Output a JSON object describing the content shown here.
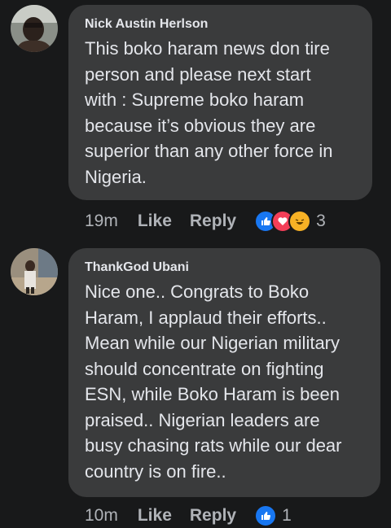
{
  "comments": [
    {
      "author": "Nick Austin Herlson",
      "text": "This boko haram news don tire\nperson and please next start\nwith : Supreme boko haram\nbecause it’s obvious they are\nsuperior than any other force in\nNigeria.",
      "time": "19m",
      "like_label": "Like",
      "reply_label": "Reply",
      "reactions": [
        "like-reaction",
        "love-reaction",
        "haha-reaction"
      ],
      "reaction_count": "3"
    },
    {
      "author": "ThankGod Ubani",
      "text": "Nice one..  Congrats to Boko\nHaram,  I applaud their efforts..\nMean while our Nigerian military\nshould concentrate on fighting\nESN,  while Boko Haram is been\npraised..  Nigerian leaders are\nbusy chasing rats while our dear\ncountry is on fire..",
      "time": "10m",
      "like_label": "Like",
      "reply_label": "Reply",
      "reactions": [
        "like-reaction"
      ],
      "reaction_count": "1"
    }
  ],
  "colors": {
    "background": "#18191a",
    "bubble": "#3a3b3c",
    "text": "#e4e6eb",
    "meta": "#b0b3b8",
    "like": "#1877f2",
    "love": "#f33e58",
    "haha": "#f7b125"
  }
}
